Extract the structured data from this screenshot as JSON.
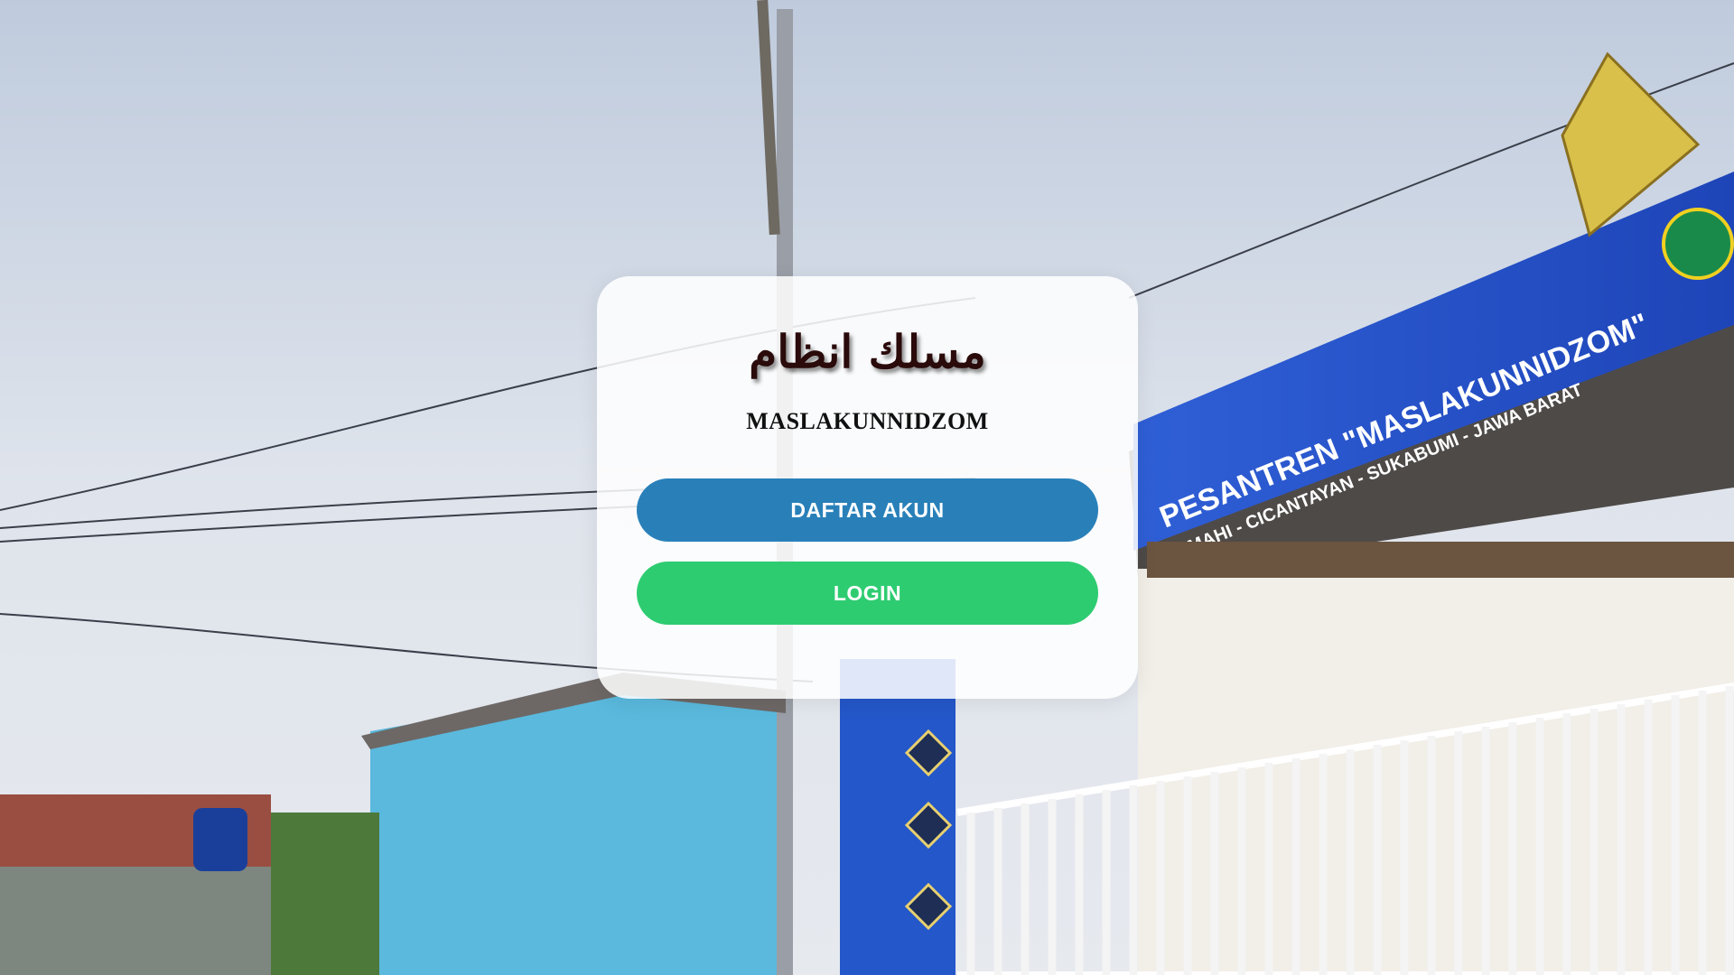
{
  "colors": {
    "register_button": "#2980b9",
    "login_button": "#2ecc71",
    "card_background": "#ffffff",
    "arabic_title_color": "#2a0a0a"
  },
  "background": {
    "banner_line_1": "PESANTREN \"MASLAKUNNIDZOM\"",
    "banner_line_2": "CIMAHI - CICANTAYAN - SUKABUMI - JAWA BARAT"
  },
  "login_card": {
    "arabic_title": "مسلك انظام",
    "title": "MASLAKUNNIDZOM",
    "register_label": "DAFTAR AKUN",
    "login_label": "LOGIN"
  }
}
